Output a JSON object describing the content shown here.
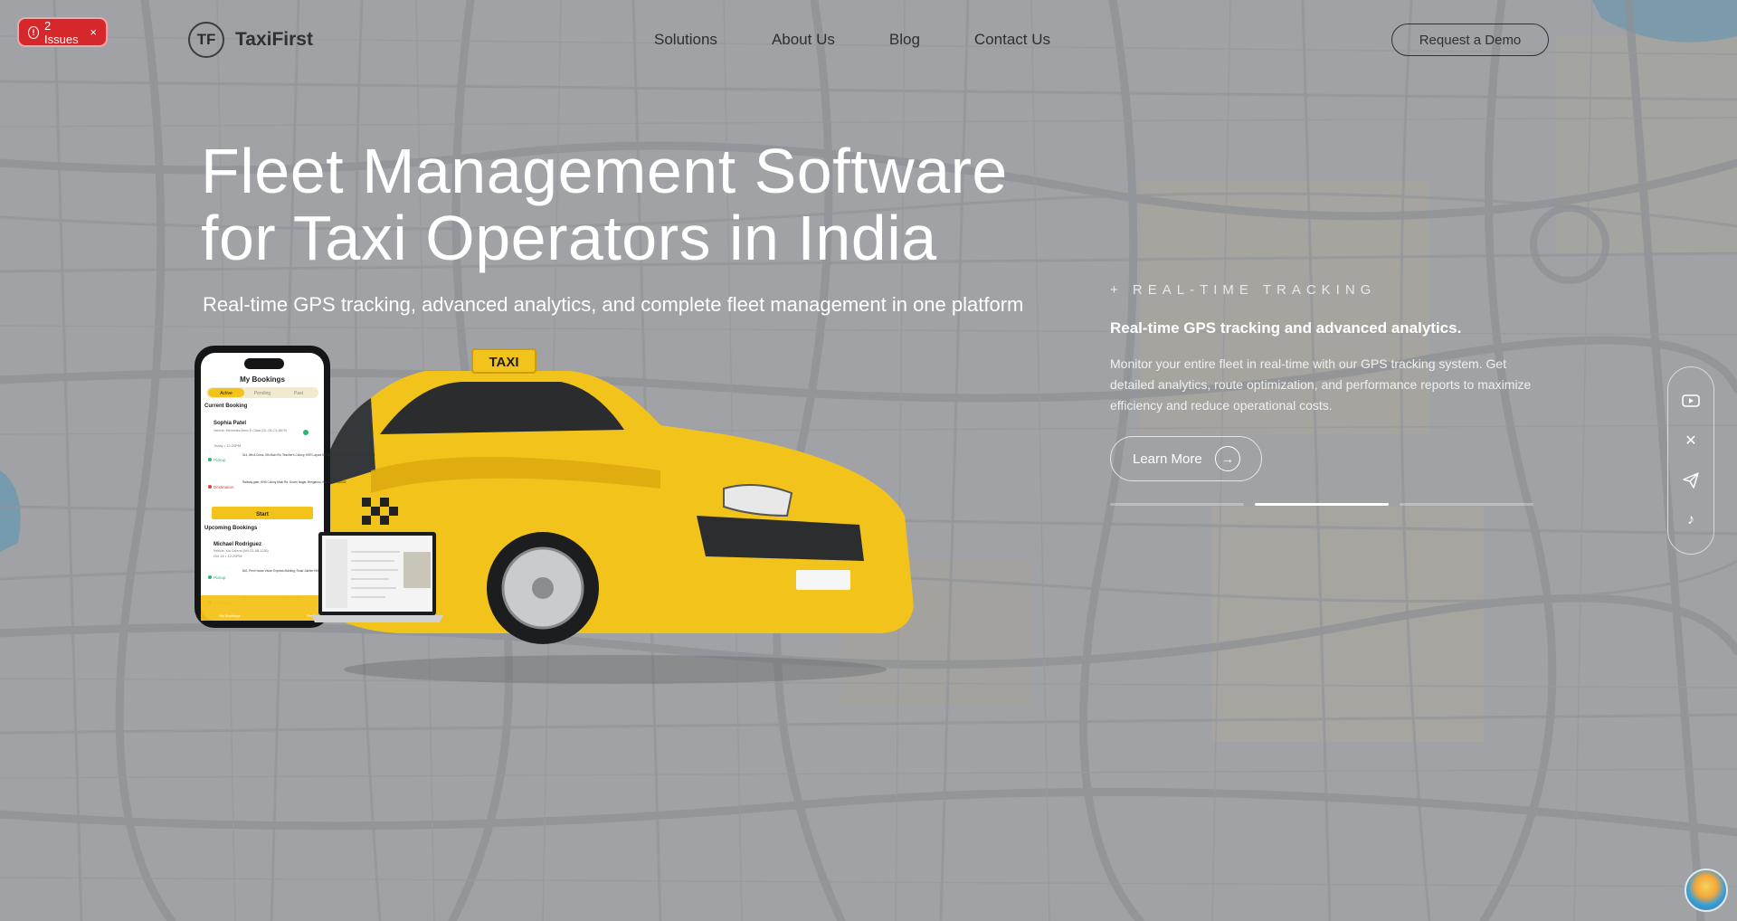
{
  "issues_badge": {
    "label": "2 Issues",
    "icon": "alert-circle-icon",
    "close": "×"
  },
  "header": {
    "logo_mark": "TF",
    "logo_text": "TaxiFirst",
    "nav": [
      "Solutions",
      "About Us",
      "Blog",
      "Contact Us"
    ],
    "cta": "Request a Demo"
  },
  "hero": {
    "title_line1": "Fleet Management Software",
    "title_line2": "for Taxi Operators in India",
    "subtitle": "Real-time GPS tracking, advanced analytics, and complete fleet management in one platform"
  },
  "art": {
    "phone_title": "My Bookings",
    "tabs": [
      "Active",
      "Pending",
      "Past"
    ],
    "current_label": "Current Booking",
    "booking1_name": "Sophia Patel",
    "booking1_vehicle": "Vehicle: Mercedes-Benz E-Class (DL-05-CX-8679)",
    "booking1_time": "Today • 12:20PM",
    "pickup_label": "Pickup",
    "booking1_pickup": "314, 8th A Cross, 5th Main Rd, Teacher's Colony, HSR Layout 5th Sector, Bengaluru, Karnataka 560034",
    "destination_label": "Destination",
    "booking1_dest": "Railway gate, KHB Colony Main Rd, Koveri Nagar, Bengaluru, Karnataka 560032",
    "start_button": "Start",
    "upcoming_label": "Upcoming Bookings",
    "booking2_name": "Michael Rodriguez",
    "booking2_vehicle": "Vehicle: Kia Carens (MH-02-AB-1236)",
    "booking2_time": "Oct 16 • 12:20PM",
    "booking2_pickup": "842, Pent House Vision Express Building, Road Jubilee Hills, Hyderabad, Telangana 500096",
    "booking2_dest": "12/99, Barkas, Hyderabad, Telangana 500005",
    "taxi_sign": "TAXI",
    "nav_home": "My Bookings",
    "nav_profile": "Profile"
  },
  "feature": {
    "kicker": "+ REAL-TIME TRACKING",
    "heading": "Real-time GPS tracking and advanced analytics.",
    "body": "Monitor your entire fleet in real-time with our GPS tracking system. Get detailed analytics, route optimization, and performance reports to maximize efficiency and reduce operational costs.",
    "button": "Learn More",
    "active_slide": 2
  },
  "social": [
    "youtube-icon",
    "x-icon",
    "telegram-icon",
    "tiktok-icon"
  ],
  "colors": {
    "taxi_yellow": "#f2c31a",
    "issues_red": "#d6272b",
    "map_gray": "#9ea1a4"
  }
}
